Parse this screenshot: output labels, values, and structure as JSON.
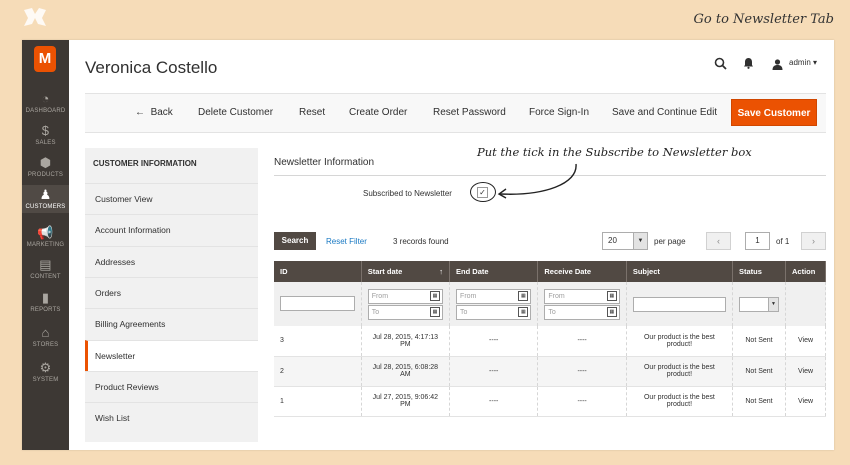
{
  "tagline": "Go to Newsletter Tab",
  "sidebar": {
    "items": [
      {
        "label": "DASHBOARD",
        "icon": "dashboard-icon",
        "glyph": "◔"
      },
      {
        "label": "SALES",
        "icon": "dollar-icon",
        "glyph": "$"
      },
      {
        "label": "PRODUCTS",
        "icon": "cube-icon",
        "glyph": "⬢"
      },
      {
        "label": "CUSTOMERS",
        "icon": "person-icon",
        "glyph": "♟"
      },
      {
        "label": "MARKETING",
        "icon": "megaphone-icon",
        "glyph": "📢"
      },
      {
        "label": "CONTENT",
        "icon": "content-icon",
        "glyph": "▤"
      },
      {
        "label": "REPORTS",
        "icon": "bar-chart-icon",
        "glyph": "▮"
      },
      {
        "label": "STORES",
        "icon": "store-icon",
        "glyph": "⌂"
      },
      {
        "label": "SYSTEM",
        "icon": "gear-icon",
        "glyph": "⚙"
      }
    ]
  },
  "header": {
    "title": "Veronica Costello",
    "user": "admin"
  },
  "toolbar": {
    "back": "Back",
    "delete": "Delete Customer",
    "reset": "Reset",
    "create_order": "Create Order",
    "reset_password": "Reset Password",
    "force_signin": "Force Sign-In",
    "save_continue": "Save and Continue Edit",
    "save": "Save Customer"
  },
  "tabs": {
    "title": "CUSTOMER INFORMATION",
    "items": [
      "Customer View",
      "Account Information",
      "Addresses",
      "Orders",
      "Billing Agreements",
      "Newsletter",
      "Product Reviews",
      "Wish List"
    ],
    "active": "Newsletter"
  },
  "newsletter": {
    "section_title": "Newsletter Information",
    "subscribe_label": "Subscribed to Newsletter",
    "subscribed": true,
    "callout": "Put the tick in the Subscribe to Newsletter box"
  },
  "grid": {
    "search": "Search",
    "reset_filter": "Reset Filter",
    "records": "3 records found",
    "per_page_value": "20",
    "per_page_label": "per page",
    "page": "1",
    "of_pages": "of 1",
    "columns": [
      "ID",
      "Start date",
      "End Date",
      "Receive Date",
      "Subject",
      "Status",
      "Action"
    ],
    "sort_indicator": "↑",
    "filter_from": "From",
    "filter_to": "To",
    "rows": [
      {
        "id": "3",
        "start_date": "Jul 28, 2015, 4:17:13 PM",
        "end_date": "----",
        "receive_date": "----",
        "subject": "Our product is the best product!",
        "status": "Not Sent",
        "action": "View"
      },
      {
        "id": "2",
        "start_date": "Jul 28, 2015, 6:08:28 AM",
        "end_date": "----",
        "receive_date": "----",
        "subject": "Our product is the best product!",
        "status": "Not Sent",
        "action": "View"
      },
      {
        "id": "1",
        "start_date": "Jul 27, 2015, 9:06:42 PM",
        "end_date": "----",
        "receive_date": "----",
        "subject": "Our product is the best product!",
        "status": "Not Sent",
        "action": "View"
      }
    ]
  },
  "colors": {
    "accent": "#eb5202",
    "sidebar": "#3d3834",
    "background": "#f6dcb8",
    "link": "#1979c3"
  }
}
